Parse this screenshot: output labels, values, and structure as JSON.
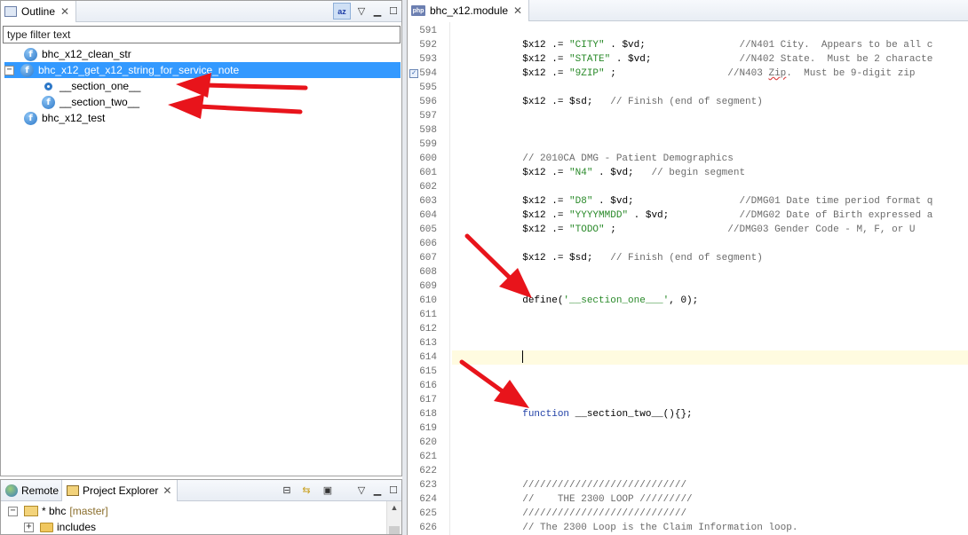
{
  "outline": {
    "tab_label": "Outline",
    "sort_icon_label": "az",
    "filter_placeholder": "type filter text",
    "items": [
      {
        "label": "bhc_x12_clean_str",
        "kind": "function",
        "selected": false
      },
      {
        "label": "bhc_x12_get_x12_string_for_service_note",
        "kind": "function",
        "selected": true,
        "expanded": true
      },
      {
        "label": "__section_one__",
        "kind": "constant",
        "selected": false
      },
      {
        "label": "__section_two__",
        "kind": "function",
        "selected": false
      },
      {
        "label": "bhc_x12_test",
        "kind": "function",
        "selected": false
      }
    ]
  },
  "explorer": {
    "tabs": [
      "Remote",
      "Project Explorer"
    ],
    "project": {
      "prefix": "* bhc",
      "branch": "[master]"
    },
    "folder": "includes"
  },
  "editor": {
    "tab_label": "bhc_x12.module",
    "lines": [
      {
        "n": "591",
        "segs": []
      },
      {
        "n": "592",
        "segs": [
          [
            "v",
            "            $x12 .= "
          ],
          [
            "s",
            "\"CITY\""
          ],
          [
            "v",
            " . $vd;                "
          ],
          [
            "c",
            "//N401 City.  Appears to be all c"
          ]
        ]
      },
      {
        "n": "593",
        "segs": [
          [
            "v",
            "            $x12 .= "
          ],
          [
            "s",
            "\"STATE\""
          ],
          [
            "v",
            " . $vd;               "
          ],
          [
            "c",
            "//N402 State.  Must be 2 characte"
          ]
        ]
      },
      {
        "n": "594",
        "segs": [
          [
            "v",
            "            $x12 .= "
          ],
          [
            "s",
            "\"9ZIP\""
          ],
          [
            "v",
            " ;                   "
          ],
          [
            "c",
            "//N403 "
          ],
          [
            "cq",
            "Zip"
          ],
          [
            "c",
            ".  Must be 9-digit zip"
          ]
        ]
      },
      {
        "n": "595",
        "segs": []
      },
      {
        "n": "596",
        "segs": [
          [
            "v",
            "            $x12 .= $sd;   "
          ],
          [
            "c",
            "// Finish (end of segment)"
          ]
        ]
      },
      {
        "n": "597",
        "segs": []
      },
      {
        "n": "598",
        "segs": []
      },
      {
        "n": "599",
        "segs": []
      },
      {
        "n": "600",
        "segs": [
          [
            "c",
            "            // 2010CA DMG - Patient Demographics"
          ]
        ]
      },
      {
        "n": "601",
        "segs": [
          [
            "v",
            "            $x12 .= "
          ],
          [
            "s",
            "\"N4\""
          ],
          [
            "v",
            " . $vd;   "
          ],
          [
            "c",
            "// begin segment"
          ]
        ]
      },
      {
        "n": "602",
        "segs": []
      },
      {
        "n": "603",
        "segs": [
          [
            "v",
            "            $x12 .= "
          ],
          [
            "s",
            "\"D8\""
          ],
          [
            "v",
            " . $vd;                  "
          ],
          [
            "c",
            "//DMG01 Date time period format q"
          ]
        ]
      },
      {
        "n": "604",
        "segs": [
          [
            "v",
            "            $x12 .= "
          ],
          [
            "s",
            "\"YYYYMMDD\""
          ],
          [
            "v",
            " . $vd;            "
          ],
          [
            "c",
            "//DMG02 Date of Birth expressed a"
          ]
        ]
      },
      {
        "n": "605",
        "segs": [
          [
            "v",
            "            $x12 .= "
          ],
          [
            "s",
            "\"TODO\""
          ],
          [
            "v",
            " ;                   "
          ],
          [
            "c",
            "//DMG03 Gender Code - M, F, or U"
          ]
        ]
      },
      {
        "n": "606",
        "segs": []
      },
      {
        "n": "607",
        "segs": [
          [
            "v",
            "            $x12 .= $sd;   "
          ],
          [
            "c",
            "// Finish (end of segment)"
          ]
        ]
      },
      {
        "n": "608",
        "segs": []
      },
      {
        "n": "609",
        "segs": []
      },
      {
        "n": "610",
        "segs": [
          [
            "v",
            "            define("
          ],
          [
            "s",
            "'__section_one___'"
          ],
          [
            "v",
            ", 0);"
          ]
        ]
      },
      {
        "n": "611",
        "segs": []
      },
      {
        "n": "612",
        "segs": []
      },
      {
        "n": "613",
        "segs": []
      },
      {
        "n": "614",
        "segs": [],
        "current": true
      },
      {
        "n": "615",
        "segs": []
      },
      {
        "n": "616",
        "segs": []
      },
      {
        "n": "617",
        "segs": []
      },
      {
        "n": "618",
        "segs": [
          [
            "k",
            "            function"
          ],
          [
            "v",
            " __section_two__(){};"
          ]
        ]
      },
      {
        "n": "619",
        "segs": []
      },
      {
        "n": "620",
        "segs": []
      },
      {
        "n": "621",
        "segs": []
      },
      {
        "n": "622",
        "segs": []
      },
      {
        "n": "623",
        "segs": [
          [
            "c",
            "            ////////////////////////////"
          ]
        ]
      },
      {
        "n": "624",
        "segs": [
          [
            "c",
            "            //    THE 2300 LOOP /////////"
          ]
        ]
      },
      {
        "n": "625",
        "segs": [
          [
            "c",
            "            ////////////////////////////"
          ]
        ]
      },
      {
        "n": "626",
        "segs": [
          [
            "c",
            "            // The 2300 Loop is the Claim Information loop."
          ]
        ]
      }
    ]
  },
  "colors": {
    "selection": "#3399ff",
    "arrow": "#e8141b",
    "string": "#2a8a2a",
    "comment": "#6b6b6b",
    "keyword": "#1f3fa6"
  }
}
